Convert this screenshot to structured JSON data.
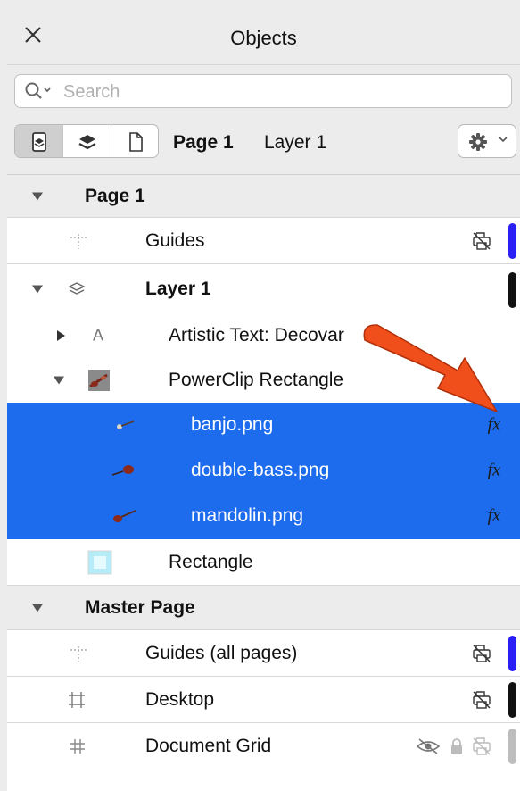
{
  "panel": {
    "title": "Objects",
    "close_icon": "close-icon"
  },
  "search": {
    "placeholder": "Search"
  },
  "toolbar": {
    "buttons": [
      "layer-view-icon",
      "layers-stack-icon",
      "page-icon"
    ],
    "page_label": "Page 1",
    "layer_label": "Layer 1",
    "options_icon": "gear-icon"
  },
  "tree": {
    "page1": "Page 1",
    "guides": "Guides",
    "layer1": "Layer 1",
    "artistic_text": "Artistic Text: Decovar",
    "powerclip": "PowerClip Rectangle",
    "banjo": "banjo.png",
    "double_bass": "double-bass.png",
    "mandolin": "mandolin.png",
    "rectangle": "Rectangle",
    "master_page": "Master Page",
    "guides_all": "Guides (all pages)",
    "desktop": "Desktop",
    "document_grid": "Document Grid"
  },
  "effects_label": "fx",
  "colors": {
    "selection": "#1d6ced",
    "guides_layer": "#2a1ff5",
    "layer1": "#111111",
    "grid_layer": "#bdbdbd",
    "annotation_arrow": "#f04e1a"
  }
}
